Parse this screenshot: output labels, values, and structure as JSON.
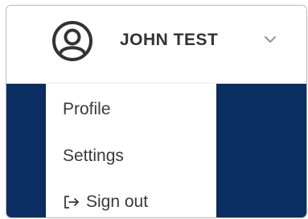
{
  "user": {
    "name": "JOHN TEST",
    "avatar_icon": "user-circle-icon",
    "dropdown_icon": "chevron-down-icon"
  },
  "menu": {
    "items": [
      {
        "label": "Profile"
      },
      {
        "label": "Settings"
      },
      {
        "label": "Sign out",
        "icon": "sign-out-icon"
      }
    ]
  },
  "colors": {
    "accent_blue": "#0b2f63",
    "text": "#333333",
    "chevron": "#9a9a9a"
  }
}
